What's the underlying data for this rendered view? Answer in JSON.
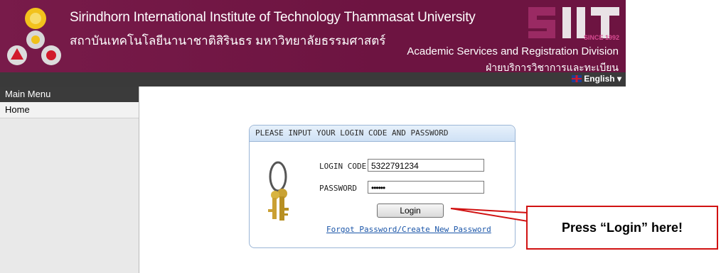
{
  "header": {
    "title_en": "Sirindhorn International Institute of Technology Thammasat University",
    "title_th": "สถาบันเทคโนโลยีนานาชาติสิรินธร มหาวิทยาลัยธรรมศาสตร์",
    "siit_logo": "SIIT",
    "siit_since": "SINCE 1992",
    "division_en": "Academic Services and Registration Division",
    "division_th": "ฝ่ายบริการวิชาการและทะเบียน",
    "language": "English",
    "colors": {
      "banner": "#6d1441",
      "strip": "#3a3a3a"
    }
  },
  "sidebar": {
    "title": "Main Menu",
    "items": [
      {
        "label": "Home"
      }
    ]
  },
  "login": {
    "heading": "PLEASE INPUT YOUR LOGIN CODE AND PASSWORD",
    "login_code_label": "LOGIN CODE",
    "login_code_value": "5322791234",
    "password_label": "PASSWORD",
    "password_value": "••••••",
    "login_button": "Login",
    "forgot_link": "Forgot Password/Create New Password"
  },
  "callout": {
    "text": "Press “Login” here!",
    "color": "#d11212"
  }
}
